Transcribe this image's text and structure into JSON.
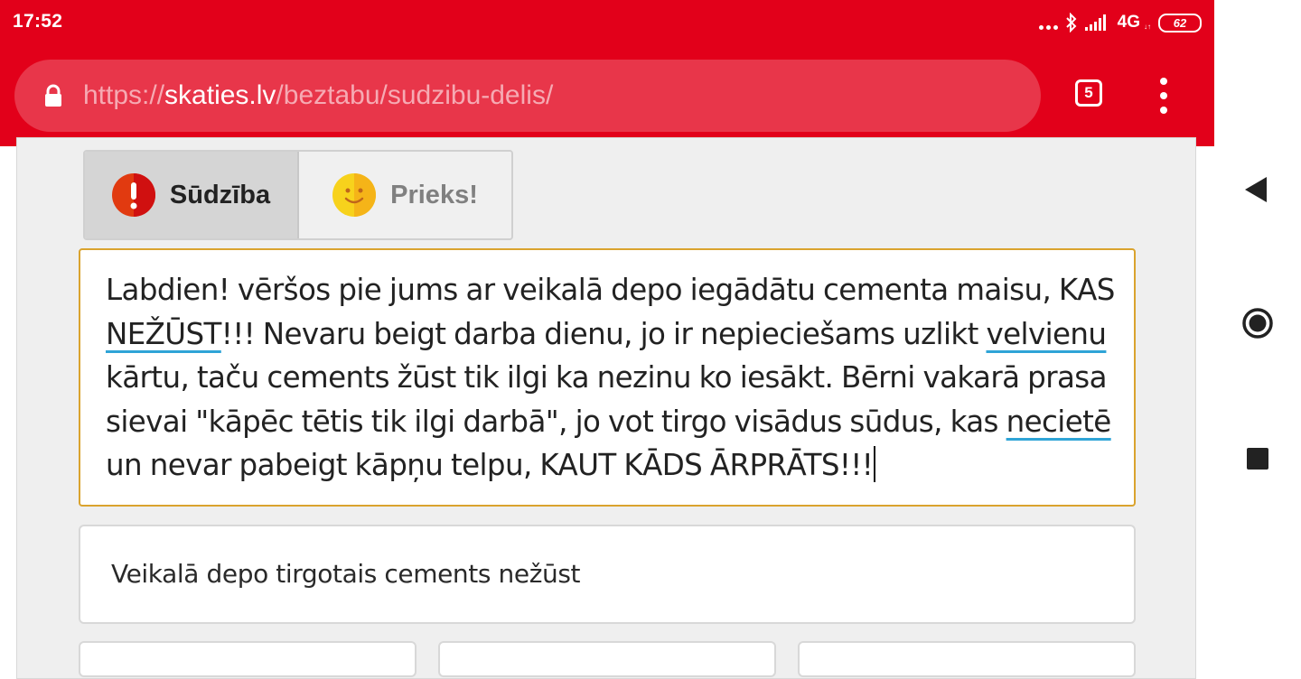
{
  "status_bar": {
    "time": "17:52",
    "network": "4G",
    "network_sub": "↓↑",
    "battery": "62",
    "icons": [
      "more-dots-icon",
      "bluetooth-icon",
      "signal-icon",
      "battery-icon"
    ]
  },
  "browser": {
    "url_scheme": "https://",
    "url_host": "skaties.lv",
    "url_path": "/beztabu/sudzibu-delis/",
    "tab_count": "5",
    "accent_color": "#e2001a"
  },
  "form": {
    "toggle": {
      "complaint_label": "Sūdzība",
      "joy_label": "Prieks!",
      "selected": "Sūdzība"
    },
    "complaint": {
      "t1": "Labdien! vēršos pie jums ar veikalā depo iegādātu cementa maisu, KAS ",
      "w1": "NEŽŪST",
      "t2": "!!! Nevaru beigt darba dienu, jo ir nepieciešams uzlikt ",
      "w2": "velvienu",
      "t3": " kārtu, taču cements žūst tik ilgi ka nezinu ko iesākt. Bērni vakarā prasa sievai \"kāpēc tētis tik ilgi darbā\", jo vot tirgo visādus sūdus, kas ",
      "w3": "necietē",
      "t4": " un nevar pabeigt kāpņu telpu, KAUT KĀDS ĀRPRĀTS!!!"
    },
    "title_value": "Veikalā depo tirgotais cements nežūst"
  }
}
